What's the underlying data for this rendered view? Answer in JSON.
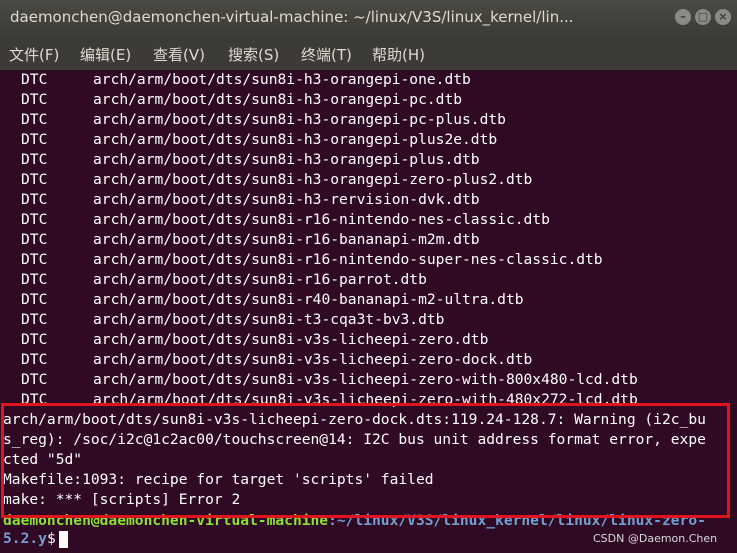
{
  "window": {
    "title": "daemonchen@daemonchen-virtual-machine: ~/linux/V3S/linux_kernel/lin...",
    "minimize_glyph": "–",
    "maximize_glyph": "□",
    "close_glyph": "×"
  },
  "menu": [
    {
      "label": "文件(F)"
    },
    {
      "label": "编辑(E)"
    },
    {
      "label": "查看(V)"
    },
    {
      "label": "搜索(S)"
    },
    {
      "label": "终端(T)"
    },
    {
      "label": "帮助(H)"
    }
  ],
  "terminal": {
    "build_lines": [
      {
        "tag": "DTC",
        "path": "arch/arm/boot/dts/sun8i-h3-orangepi-one.dtb"
      },
      {
        "tag": "DTC",
        "path": "arch/arm/boot/dts/sun8i-h3-orangepi-pc.dtb"
      },
      {
        "tag": "DTC",
        "path": "arch/arm/boot/dts/sun8i-h3-orangepi-pc-plus.dtb"
      },
      {
        "tag": "DTC",
        "path": "arch/arm/boot/dts/sun8i-h3-orangepi-plus2e.dtb"
      },
      {
        "tag": "DTC",
        "path": "arch/arm/boot/dts/sun8i-h3-orangepi-plus.dtb"
      },
      {
        "tag": "DTC",
        "path": "arch/arm/boot/dts/sun8i-h3-orangepi-zero-plus2.dtb"
      },
      {
        "tag": "DTC",
        "path": "arch/arm/boot/dts/sun8i-h3-rervision-dvk.dtb"
      },
      {
        "tag": "DTC",
        "path": "arch/arm/boot/dts/sun8i-r16-nintendo-nes-classic.dtb"
      },
      {
        "tag": "DTC",
        "path": "arch/arm/boot/dts/sun8i-r16-bananapi-m2m.dtb"
      },
      {
        "tag": "DTC",
        "path": "arch/arm/boot/dts/sun8i-r16-nintendo-super-nes-classic.dtb"
      },
      {
        "tag": "DTC",
        "path": "arch/arm/boot/dts/sun8i-r16-parrot.dtb"
      },
      {
        "tag": "DTC",
        "path": "arch/arm/boot/dts/sun8i-r40-bananapi-m2-ultra.dtb"
      },
      {
        "tag": "DTC",
        "path": "arch/arm/boot/dts/sun8i-t3-cqa3t-bv3.dtb"
      },
      {
        "tag": "DTC",
        "path": "arch/arm/boot/dts/sun8i-v3s-licheepi-zero.dtb"
      },
      {
        "tag": "DTC",
        "path": "arch/arm/boot/dts/sun8i-v3s-licheepi-zero-dock.dtb"
      },
      {
        "tag": "DTC",
        "path": "arch/arm/boot/dts/sun8i-v3s-licheepi-zero-with-800x480-lcd.dtb"
      },
      {
        "tag": "DTC",
        "path": "arch/arm/boot/dts/sun8i-v3s-licheepi-zero-with-480x272-lcd.dtb"
      }
    ],
    "error_lines": [
      "arch/arm/boot/dts/sun8i-v3s-licheepi-zero-dock.dts:119.24-128.7: Warning (i2c_bu",
      "s_reg): /soc/i2c@1c2ac00/touchscreen@14: I2C bus unit address format error, expe",
      "cted \"5d\"",
      "Makefile:1093: recipe for target 'scripts' failed",
      "make: *** [scripts] Error 2"
    ],
    "prompt_user": "daemonchen@daemonchen-virtual-machine",
    "prompt_path": ":~/linux/V3S/linux_kernel/linux/linux-zero-",
    "prompt_wrap": "5.2.y",
    "prompt_symbol": "$"
  },
  "watermark": "CSDN @Daemon.Chen"
}
